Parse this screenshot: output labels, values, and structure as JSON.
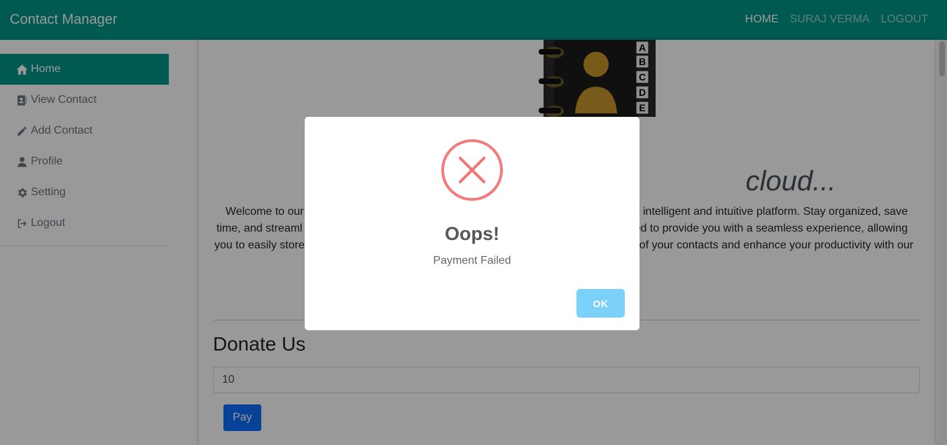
{
  "navbar": {
    "brand": "Contact Manager",
    "links": [
      {
        "label": "HOME",
        "active": true
      },
      {
        "label": "SURAJ VERMA",
        "active": false
      },
      {
        "label": "LOGOUT",
        "active": false
      }
    ],
    "color": "#009688"
  },
  "sidebar": {
    "items": [
      {
        "label": "Home",
        "icon": "home-icon",
        "active": true
      },
      {
        "label": "View Contact",
        "icon": "address-book-icon",
        "active": false
      },
      {
        "label": "Add Contact",
        "icon": "pencil-icon",
        "active": false
      },
      {
        "label": "Profile",
        "icon": "user-icon",
        "active": false
      },
      {
        "label": "Setting",
        "icon": "gear-icon",
        "active": false
      },
      {
        "label": "Logout",
        "icon": "sign-out-icon",
        "active": false
      }
    ]
  },
  "main": {
    "hero_title": "cloud...",
    "intro_lines": [
      "Welcome to our",
      "intelligent and intuitive platform. Stay organized, save",
      "time, and streaml",
      "ed to provide you with a seamless experience, allowing",
      "you to easily store",
      "l of your contacts and enhance your productivity with our"
    ],
    "donate": {
      "title": "Donate Us",
      "amount_value": "10",
      "pay_label": "Pay",
      "pay_color": "#0d6efd"
    },
    "book_index_letters": [
      "A",
      "B",
      "C",
      "D",
      "E"
    ]
  },
  "modal": {
    "icon": "error-x-icon",
    "title": "Oops!",
    "text": "Payment Failed",
    "ok_label": "OK",
    "ok_color": "#7cd1f9",
    "error_color": "#f27474"
  }
}
